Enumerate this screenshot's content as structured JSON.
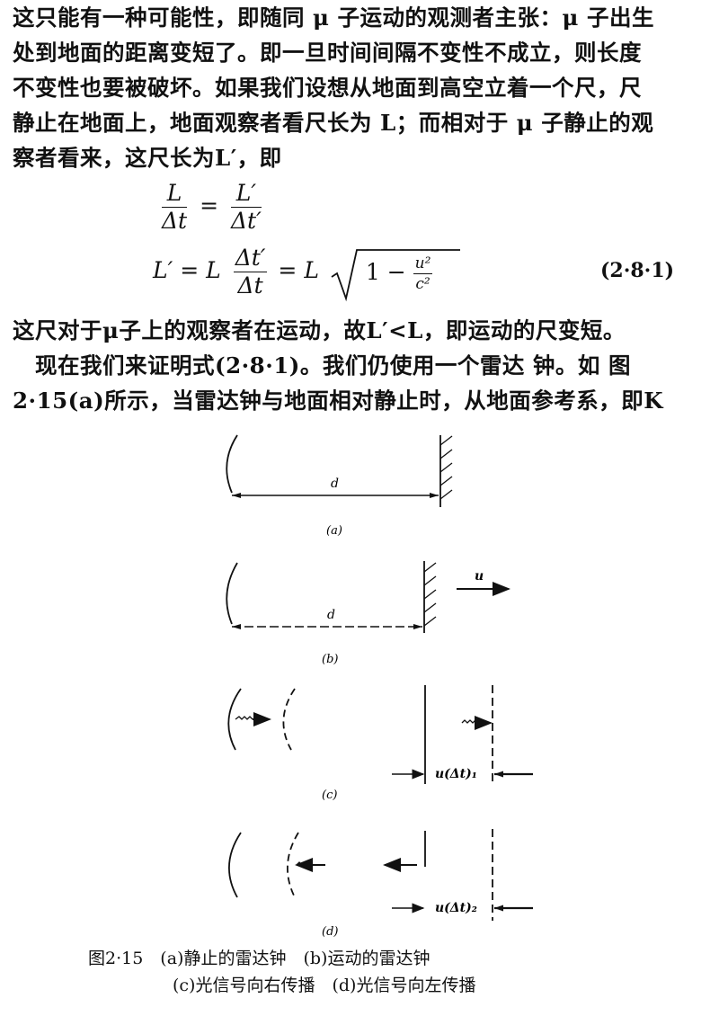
{
  "text": {
    "para1": [
      "这只能有一种可能性，即随同 μ 子运动的观测者主张：μ 子出生",
      "处到地面的距离变短了。即一旦时间间隔不变性不成立，则长度",
      "不变性也要被破坏。如果我们设想从地面到高空立着一个尺，尺",
      "静止在地面上，地面观察者看尺长为 L；而相对于 μ 子静止的观",
      "察者看来，这尺长为L′，即"
    ],
    "para2": [
      "这尺对于μ子上的观察者在运动，故L′<L，即运动的尺变短。",
      "　现在我们来证明式(2·8·1)。我们仍使用一个雷达 钟。如 图",
      "2·15(a)所示，当雷达钟与地面相对静止时，从地面参考系，即K"
    ]
  },
  "equation": {
    "line1": {
      "lhs_num": "L",
      "lhs_den": "Δt",
      "rhs_num": "L′",
      "rhs_den": "Δt′"
    },
    "line2": {
      "lhs": "L′ = L",
      "frac_num": "Δt′",
      "frac_den": "Δt",
      "mid": "= L",
      "radicand_one": "1 −",
      "u2": "u²",
      "c2": "c²"
    },
    "number": "(2·8·1)"
  },
  "figure": {
    "labels": {
      "d_a": "d",
      "d_b": "d",
      "u": "u",
      "c_dt": "u(Δt)₁",
      "d_dt": "u(Δt)₂"
    },
    "sublabels": [
      "(a)",
      "(b)",
      "(c)",
      "(d)"
    ],
    "caption_line1": "图2·15　(a)静止的雷达钟　(b)运动的雷达钟",
    "caption_line2": "(c)光信号向右传播　(d)光信号向左传播"
  }
}
